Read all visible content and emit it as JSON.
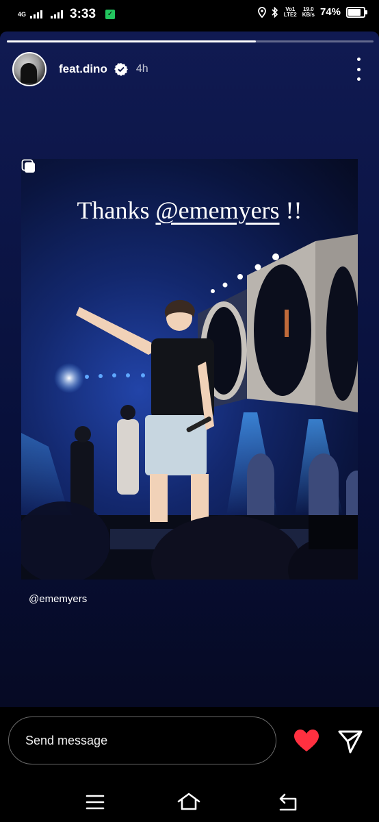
{
  "status_bar": {
    "network": "4G",
    "time": "3:33",
    "volte_line1": "Vo1",
    "volte_line2": "LTE2",
    "speed_value": "19.0",
    "speed_unit": "KB/s",
    "battery_percent": "74%",
    "battery_level": 0.74
  },
  "story": {
    "progress": 0.68,
    "username": "feat.dino",
    "time_ago": "4h",
    "photo_caption_prefix": "Thanks ",
    "photo_caption_mention": "@ememyers",
    "photo_caption_suffix": " !!",
    "credit": "@ememyers"
  },
  "reply": {
    "placeholder": "Send message",
    "like_icon_color": "#ff3040"
  },
  "icons": {
    "like": "heart-icon",
    "send": "paper-plane-icon",
    "more": "three-dots-vertical-icon",
    "verified": "verified-badge-icon",
    "nav_menu": "recent-apps-icon",
    "nav_home": "home-icon",
    "nav_back": "back-icon"
  }
}
